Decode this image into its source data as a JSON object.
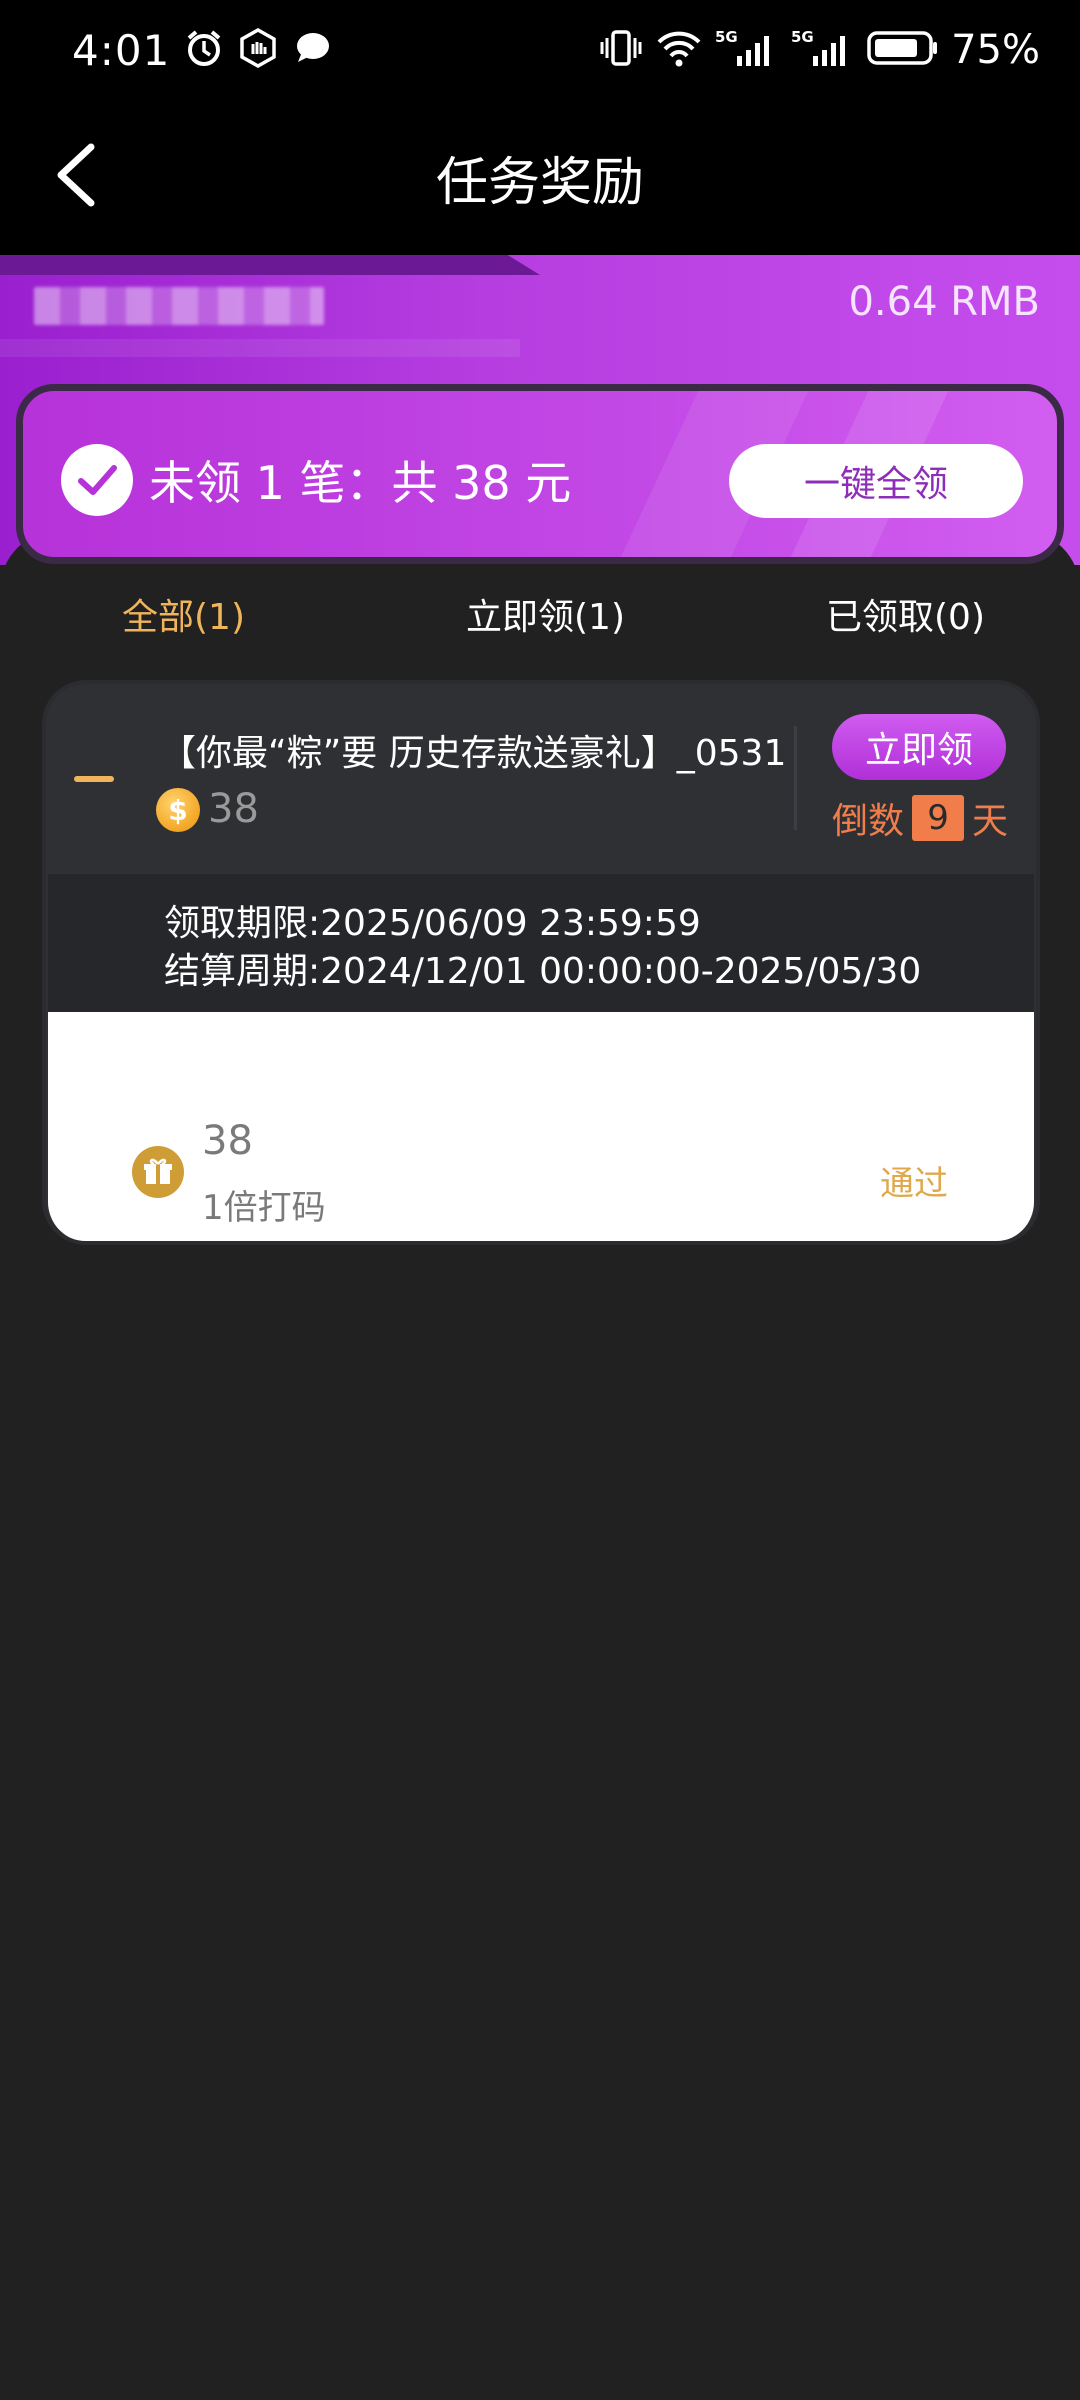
{
  "status_bar": {
    "time": "4:01",
    "battery": "75%"
  },
  "nav": {
    "title": "任务奖励"
  },
  "banner": {
    "balance": "0.64 RMB"
  },
  "claim_card": {
    "summary": "未领 1 笔：共 38 元",
    "button": "一键全领"
  },
  "tabs": [
    {
      "label": "全部(1)",
      "active": true
    },
    {
      "label": "立即领(1)",
      "active": false
    },
    {
      "label": "已领取(0)",
      "active": false
    }
  ],
  "task": {
    "title": "【你最“粽”要 历史存款送豪礼】_0531",
    "amount": "38",
    "claim_button": "立即领",
    "countdown_prefix": "倒数",
    "countdown_days": "9",
    "countdown_suffix": "天",
    "deadline": "领取期限:2025/06/09 23:59:59",
    "period": "结算周期:2024/12/01 00:00:00-2025/05/30",
    "bonus_amount": "38",
    "bonus_rule": "1倍打码",
    "status": "通过"
  },
  "colors": {
    "accent": "#f0b45b",
    "purple": "#b632d9",
    "countdown": "#f07d4a"
  }
}
